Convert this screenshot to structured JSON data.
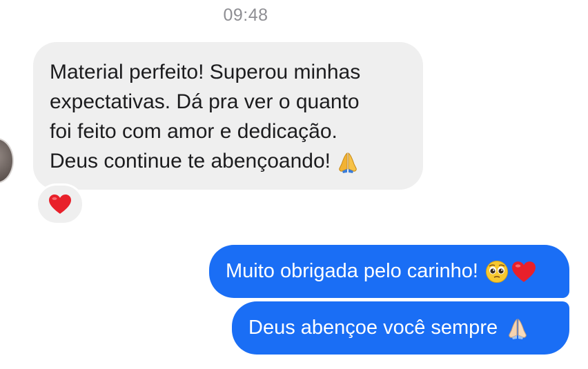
{
  "conversation": {
    "timestamp": "09:48",
    "incoming_message": {
      "lines": [
        "Material perfeito! Superou minhas",
        "expectativas. Dá pra ver o quanto",
        "foi feito com amor e dedicação.",
        "Deus continue te abençoando!"
      ],
      "trailing_emoji": "folded-hands-icon",
      "reaction": "red-heart-icon"
    },
    "outgoing_messages": [
      {
        "text": "Muito obrigada pelo carinho!",
        "emojis": [
          "pleading-face-icon",
          "red-heart-icon"
        ]
      },
      {
        "text": "Deus abençoe você sempre",
        "emojis": [
          "folded-hands-icon"
        ]
      }
    ]
  },
  "colors": {
    "incoming_bubble": "#efefef",
    "outgoing_bubble": "#1a6ef5",
    "timestamp_text": "#8e8e93"
  }
}
